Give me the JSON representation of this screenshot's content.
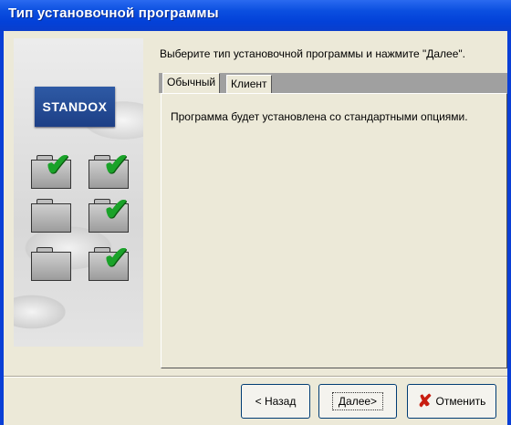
{
  "window": {
    "title": "Тип установочной программы"
  },
  "branding": {
    "logo_text": "STANDOX"
  },
  "instruction": "Выберите тип установочной программы и нажмите \"Далее\".",
  "tabs": [
    {
      "label": "Обычный",
      "selected": true
    },
    {
      "label": "Клиент",
      "selected": false
    }
  ],
  "panel": {
    "text": "Программа будет установлена со стандартными опциями."
  },
  "buttons": {
    "back": "< Назад",
    "next": "Далее>",
    "cancel": "Отменить"
  },
  "colors": {
    "titlebar": "#0341d8",
    "dialog_bg": "#ece9d8",
    "check": "#1aa229",
    "cancel_icon": "#c81d10"
  },
  "icons": {
    "cancel": "red-x-icon",
    "feature": "folder-icon",
    "selected": "checkmark-icon"
  }
}
